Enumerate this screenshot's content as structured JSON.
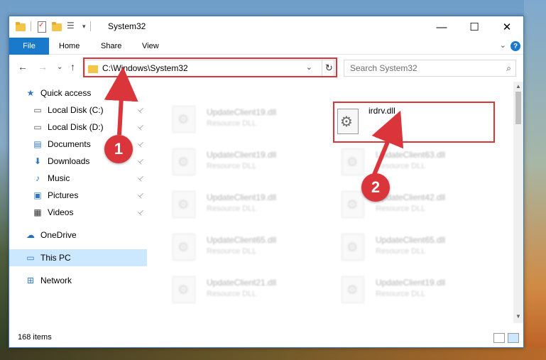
{
  "window": {
    "title": "System32",
    "minimize": "—",
    "maximize": "☐",
    "close": "✕"
  },
  "ribbon": {
    "tabs": [
      "File",
      "Home",
      "Share",
      "View"
    ],
    "help": "?",
    "expand": "⌄"
  },
  "nav": {
    "back": "←",
    "forward": "→",
    "recent": "⌄",
    "up": "↑",
    "address": "C:\\Windows\\System32",
    "address_dropdown": "⌄",
    "refresh": "↻",
    "search_placeholder": "Search System32",
    "search_icon": "⌕"
  },
  "sidebar": {
    "items": [
      {
        "label": "Quick access",
        "icon": "star-icon",
        "glyph": "★",
        "color": "#2f78c4"
      },
      {
        "label": "Local Disk (C:)",
        "icon": "drive-icon",
        "glyph": "▭",
        "color": "#555",
        "pinned": true
      },
      {
        "label": "Local Disk (D:)",
        "icon": "drive-icon",
        "glyph": "▭",
        "color": "#555",
        "pinned": true
      },
      {
        "label": "Documents",
        "icon": "documents-icon",
        "glyph": "▤",
        "color": "#2f78c4",
        "pinned": true
      },
      {
        "label": "Downloads",
        "icon": "downloads-icon",
        "glyph": "⬇",
        "color": "#2f78c4",
        "pinned": true
      },
      {
        "label": "Music",
        "icon": "music-icon",
        "glyph": "♪",
        "color": "#2f78c4",
        "pinned": true
      },
      {
        "label": "Pictures",
        "icon": "pictures-icon",
        "glyph": "▣",
        "color": "#2f78c4",
        "pinned": true
      },
      {
        "label": "Videos",
        "icon": "videos-icon",
        "glyph": "▦",
        "color": "#333",
        "pinned": true
      },
      {
        "label": "OneDrive",
        "icon": "cloud-icon",
        "glyph": "☁",
        "color": "#1e6fc0"
      },
      {
        "label": "This PC",
        "icon": "computer-icon",
        "glyph": "▭",
        "color": "#2f78c4"
      },
      {
        "label": "Network",
        "icon": "network-icon",
        "glyph": "⊞",
        "color": "#2f78c4"
      }
    ],
    "selected": "This PC",
    "pin_glyph": "📌"
  },
  "files": {
    "blurred": [
      {
        "name": "UpdateClient19.dll",
        "type": "Resource DLL"
      },
      {
        "name": "UpdateClient19.dll",
        "type": "Resource DLL"
      },
      {
        "name": "UpdateClient63.dll",
        "type": "Resource DLL"
      },
      {
        "name": "UpdateClient19.dll",
        "type": "Resource DLL"
      },
      {
        "name": "UpdateClient42.dll",
        "type": "Resource DLL"
      },
      {
        "name": "UpdateClient65.dll",
        "type": "Resource DLL"
      },
      {
        "name": "UpdateClient65.dll",
        "type": "Resource DLL"
      },
      {
        "name": "UpdateClient21.dll",
        "type": "Resource DLL"
      },
      {
        "name": "UpdateClient19.dll",
        "type": "Resource DLL"
      }
    ],
    "target": {
      "name": "irdrv.dll"
    }
  },
  "status": {
    "item_count": "168 items"
  },
  "callouts": {
    "one": "1",
    "two": "2"
  },
  "colors": {
    "accent": "#1979ca",
    "highlight": "#d9353b",
    "selected_bg": "#cce8ff"
  }
}
